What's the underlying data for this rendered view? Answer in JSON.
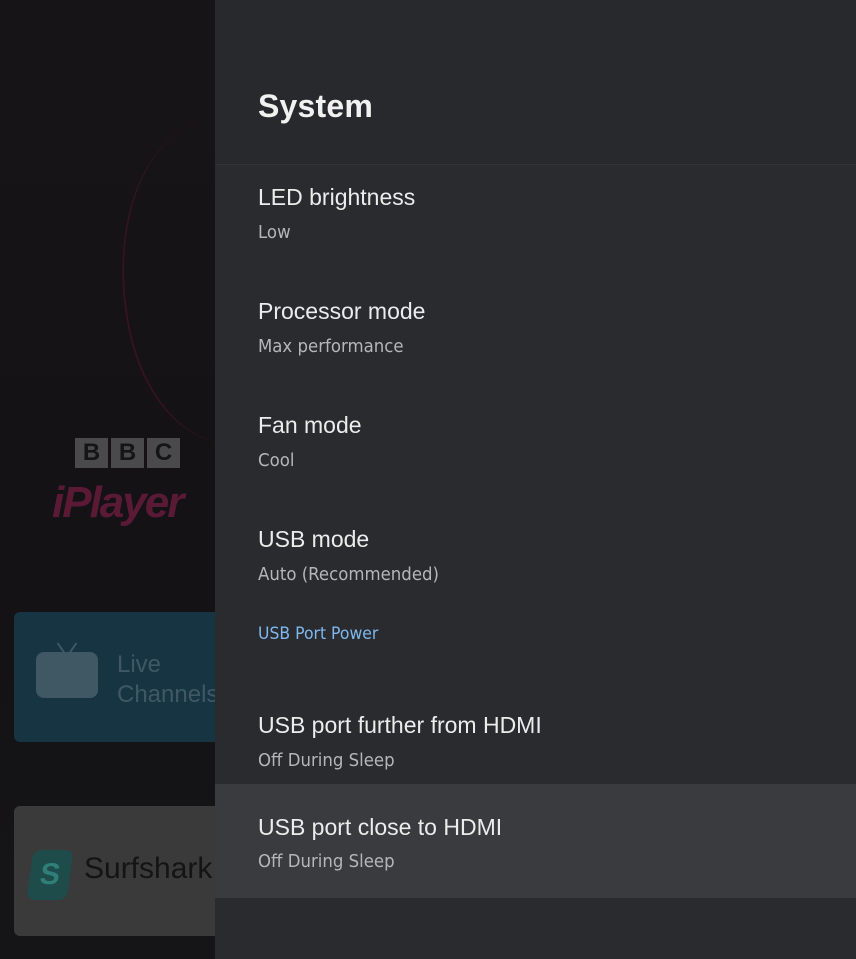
{
  "background": {
    "bbc_letters": [
      "B",
      "B",
      "C"
    ],
    "iplayer_logo": "iPlayer",
    "live_tile_label": "Live\nChannels",
    "surfshark_label": "Surfshark"
  },
  "panel": {
    "title": "System",
    "items": [
      {
        "title": "LED brightness",
        "summary": "Low"
      },
      {
        "title": "Processor mode",
        "summary": "Max performance"
      },
      {
        "title": "Fan mode",
        "summary": "Cool"
      },
      {
        "title": "USB mode",
        "summary": "Auto (Recommended)"
      }
    ],
    "category": "USB Port Power",
    "usb_items": [
      {
        "title": "USB port further from HDMI",
        "summary": "Off During Sleep"
      },
      {
        "title": "USB port close to HDMI",
        "summary": "Off During Sleep",
        "focused": true
      }
    ]
  },
  "colors": {
    "panel_bg": "#2a2b2f",
    "focus_bg": "#3a3b3f",
    "accent": "#7fb8ee"
  }
}
